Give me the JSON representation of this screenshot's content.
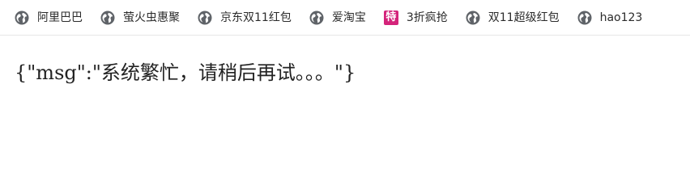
{
  "bookmarks": [
    {
      "label": "阿里巴巴",
      "icon": "globe-icon"
    },
    {
      "label": "萤火虫惠聚",
      "icon": "globe-icon"
    },
    {
      "label": "京东双11红包",
      "icon": "globe-icon"
    },
    {
      "label": "爱淘宝",
      "icon": "globe-icon"
    },
    {
      "label": "3折疯抢",
      "icon": "te-badge-icon",
      "badge_text": "特",
      "badge_color": "#d4237a"
    },
    {
      "label": "双11超级红包",
      "icon": "globe-icon"
    },
    {
      "label": "hao123",
      "icon": "globe-icon"
    }
  ],
  "page": {
    "body_text": "{\"msg\":\"系统繁忙，请稍后再试。。。\"}"
  },
  "colors": {
    "globe_icon": "#5f6368",
    "text": "#222222"
  }
}
